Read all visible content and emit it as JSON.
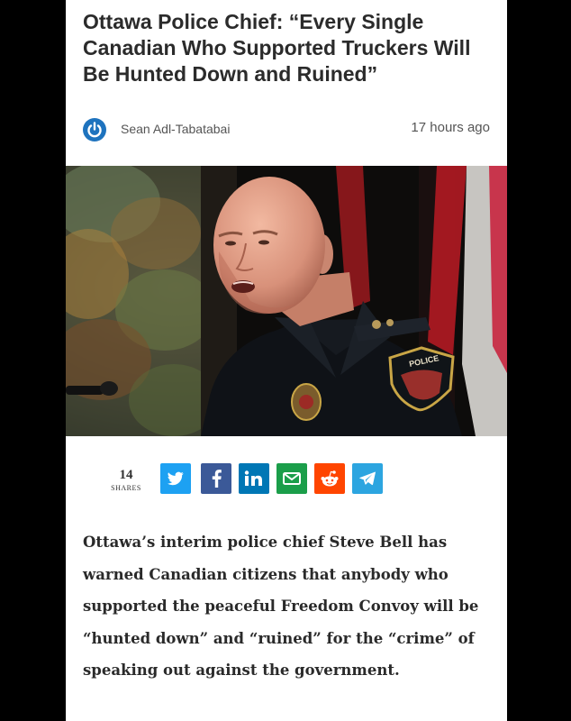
{
  "article": {
    "headline": "Ottawa Police Chief: “Every Single Canadian Who Supported Truckers Will Be Hunted Down and Ruined”",
    "author": "Sean Adl-Tabatabai",
    "timestamp": "17 hours ago",
    "photo_badge_text": "POLICE",
    "body": "Ottawa’s interim police chief Steve Bell has warned Canadian citizens that anybody who supported the peaceful Freedom Convoy will be “hunted down” and “ruined” for the “crime” of speaking out against the government."
  },
  "share": {
    "count": "14",
    "label": "SHARES",
    "buttons": [
      {
        "network": "twitter",
        "icon": "bird-icon",
        "color": "#1da1f2"
      },
      {
        "network": "facebook",
        "icon": "f-icon",
        "glyph": "f",
        "color": "#3b5998"
      },
      {
        "network": "linkedin",
        "icon": "in-icon",
        "glyph": "in",
        "color": "#0077b5"
      },
      {
        "network": "email",
        "icon": "envelope-icon",
        "color": "#1b9e4a"
      },
      {
        "network": "reddit",
        "icon": "reddit-alien-icon",
        "color": "#ff4500"
      },
      {
        "network": "telegram",
        "icon": "paper-plane-icon",
        "color": "#2ca5e0"
      }
    ]
  },
  "colors": {
    "author_logo": "#1e73be",
    "uniform": "#0f1217",
    "canada_flag_red": "#c8102e"
  }
}
